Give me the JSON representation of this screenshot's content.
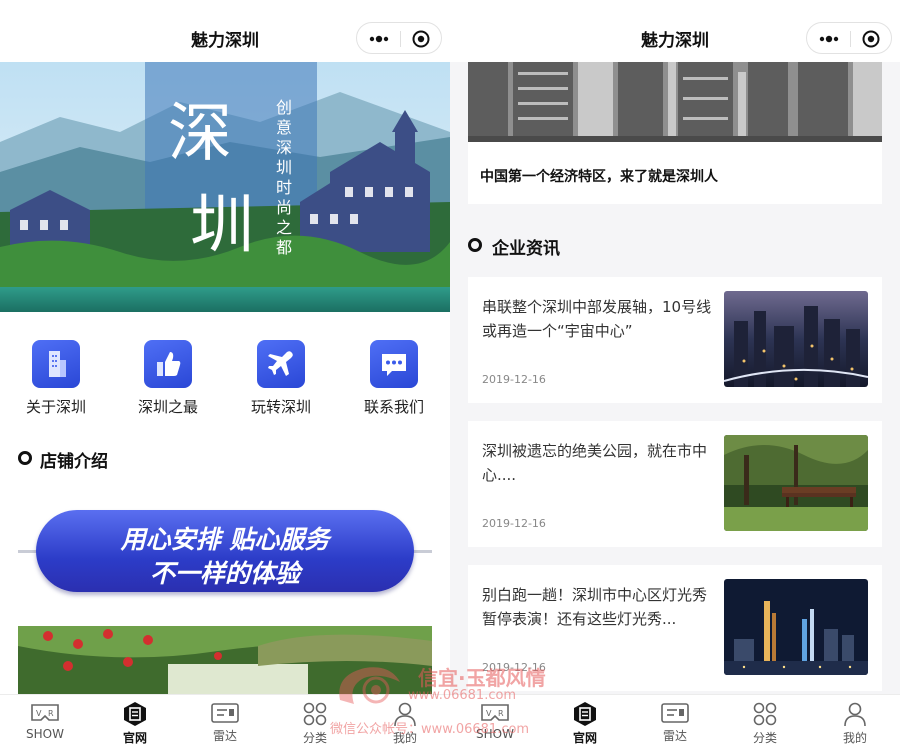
{
  "left_screen": {
    "header": {
      "title": "魅力深圳"
    },
    "banner": {
      "big_chars": [
        "深",
        "圳"
      ],
      "slogan": [
        "创意深圳",
        "时尚之都"
      ]
    },
    "nav_items": [
      {
        "label": "关于深圳",
        "icon": "building-icon"
      },
      {
        "label": "深圳之最",
        "icon": "thumbs-up-icon"
      },
      {
        "label": "玩转深圳",
        "icon": "airplane-icon"
      },
      {
        "label": "联系我们",
        "icon": "chat-icon"
      }
    ],
    "section_title": "店铺介绍",
    "promo": {
      "line1": "用心安排 贴心服务",
      "line2": "不一样的体验"
    }
  },
  "right_screen": {
    "header": {
      "title": "魅力深圳"
    },
    "top_caption": "中国第一个经济特区，来了就是深圳人",
    "section_title": "企业资讯",
    "news": [
      {
        "title": "串联整个深圳中部发展轴，10号线或再造一个“宇宙中心”",
        "date": "2019-12-16"
      },
      {
        "title": "深圳被遗忘的绝美公园，就在市中心....",
        "date": "2019-12-16"
      },
      {
        "title": "别白跑一趟！深圳市中心区灯光秀暂停表演！还有这些灯光秀...",
        "date": "2019-12-16"
      }
    ]
  },
  "tabbar": [
    {
      "label": "SHOW",
      "icon": "vr-icon"
    },
    {
      "label": "官网",
      "icon": "official-site-icon",
      "active": true
    },
    {
      "label": "雷达",
      "icon": "radar-card-icon"
    },
    {
      "label": "分类",
      "icon": "category-grid-icon"
    },
    {
      "label": "我的",
      "icon": "user-icon"
    }
  ],
  "watermark": {
    "line1": "信宜·玉都风情",
    "line2": "www.06681.com",
    "line3": "微信公众帐号：www.06681.com"
  },
  "colors": {
    "accent_blue": "#3b5bea",
    "promo_gradient_top": "#5a6ff0",
    "promo_gradient_bottom": "#2b2fb0",
    "watermark_red": "#e65a5a"
  }
}
